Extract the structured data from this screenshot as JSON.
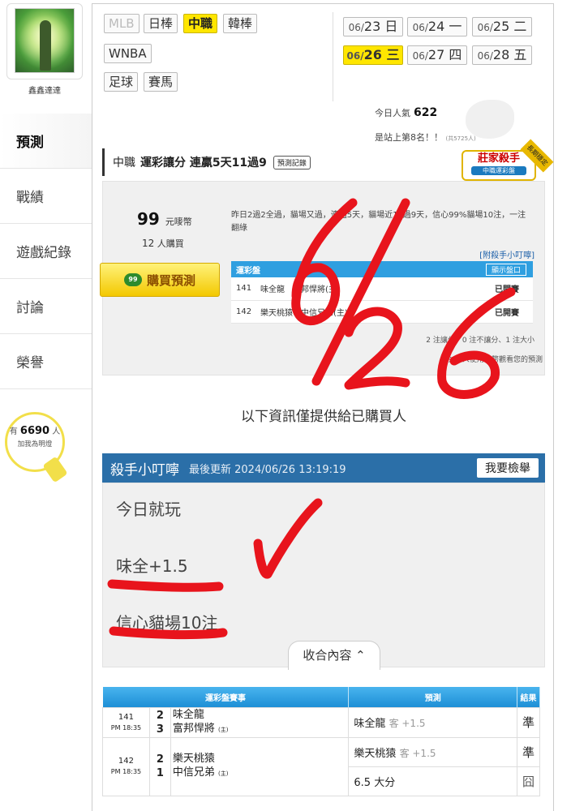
{
  "sidebar": {
    "username": "鑫鑫達達",
    "nav": [
      "預測",
      "戰績",
      "遊戲紀錄",
      "討論",
      "榮譽"
    ],
    "fans": {
      "prefix": "有",
      "count": "6690",
      "suffix": "人",
      "line2": "加我為明燈"
    }
  },
  "leagues": [
    {
      "label": "MLB",
      "state": "disabled"
    },
    {
      "label": "日棒",
      "state": "normal"
    },
    {
      "label": "中職",
      "state": "active"
    },
    {
      "label": "韓棒",
      "state": "normal"
    },
    {
      "label": "WNBA",
      "state": "normal"
    },
    {
      "label": "足球",
      "state": "normal"
    },
    {
      "label": "賽馬",
      "state": "normal"
    }
  ],
  "dates": [
    {
      "d": "06/",
      "n": "23",
      "w": "日",
      "active": false
    },
    {
      "d": "06/",
      "n": "24",
      "w": "一",
      "active": false
    },
    {
      "d": "06/",
      "n": "25",
      "w": "二",
      "active": false
    },
    {
      "d": "06/",
      "n": "26",
      "w": "三",
      "active": true
    },
    {
      "d": "06/",
      "n": "27",
      "w": "四",
      "active": false
    },
    {
      "d": "06/",
      "n": "28",
      "w": "五",
      "active": false
    }
  ],
  "popularity": {
    "label": "今日人氣",
    "value": "622"
  },
  "rank": {
    "text": "是站上第8名！！",
    "total": "(共5725人)"
  },
  "predict_title": {
    "league": "中職",
    "title": "運彩讓分 連贏5天11過9",
    "record_btn": "預測記錄"
  },
  "badge": {
    "main": "莊家殺手",
    "sub": "中職運彩盤",
    "ribbon": "長期穩定"
  },
  "buy": {
    "price": "99",
    "price_unit": "元嘜幣",
    "buyers": "12",
    "buyers_unit": "人購買",
    "button": "購買預測",
    "coin": "99",
    "description": "昨日2過2全過，貓場又過，連過5天，貓場近10過9天，信心99%貓場10注，一注翻綠",
    "kill_link": "[附殺手小叮嚀]",
    "table_head": "運彩盤",
    "show_btn": "顯示盤口",
    "rows": [
      {
        "no": "141",
        "teams": "味全龍　富邦悍將(主)",
        "status": "已開賽"
      },
      {
        "no": "142",
        "teams": "樂天桃猿　中信兄弟(主)",
        "status": "已開賽"
      }
    ],
    "summary": "2 注讓分、0 注不讓分、1 注大小",
    "summary2": "今日 人使用金幣觀看您的預測"
  },
  "info_only": "以下資訊僅提供給已購買人",
  "notes": {
    "title": "殺手小叮嚀",
    "updated": "最後更新 2024/06/26 13:19:19",
    "report_btn": "我要檢舉",
    "lines": [
      "今日就玩",
      "味全+1.5",
      "信心貓場10注"
    ],
    "collapse": "收合內容 ⌃"
  },
  "results": {
    "headers": [
      "運彩盤賽事",
      "預測",
      "結果"
    ],
    "games": [
      {
        "no": "141",
        "time": "PM 18:35",
        "away_score": "2",
        "away": "味全龍",
        "home_score": "3",
        "home": "富邦悍將",
        "home_tag": "(主)",
        "picks": [
          {
            "team": "味全龍",
            "detail": "客 +1.5",
            "result": "準"
          }
        ]
      },
      {
        "no": "142",
        "time": "PM 18:35",
        "away_score": "2",
        "away": "樂天桃猿",
        "home_score": "1",
        "home": "中信兄弟",
        "home_tag": "(主)",
        "picks": [
          {
            "team": "樂天桃猿",
            "detail": "客 +1.5",
            "result": "準"
          },
          {
            "team": "6.5 大分",
            "detail": "",
            "result": "囧"
          }
        ]
      }
    ]
  },
  "handwriting": {
    "text": "6/26",
    "color": "#e8141c"
  }
}
